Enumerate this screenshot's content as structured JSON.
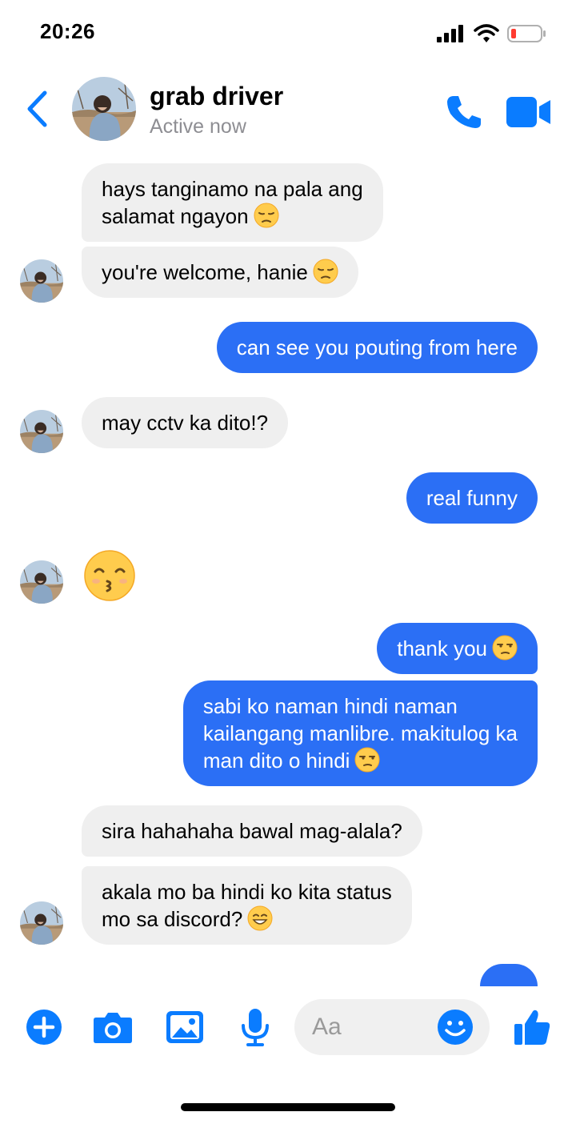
{
  "status_bar": {
    "time": "20:26"
  },
  "header": {
    "name": "grab driver",
    "status": "Active now"
  },
  "messages": {
    "m1_l1": "hays tanginamo na pala ang",
    "m1_l2": "salamat ngayon",
    "m2": "you're welcome, hanie",
    "m3": "can see you pouting from here",
    "m4": "may cctv ka dito!?",
    "m5": "real funny",
    "m6": "thank you",
    "m7_l1": "sabi ko naman hindi naman",
    "m7_l2": "kailangang manlibre. makitulog ka",
    "m7_l3": "man dito o hindi",
    "m8": "sira hahahaha bawal mag-alala?",
    "m9_l1": "akala mo ba hindi ko kita status",
    "m9_l2": "mo sa discord?"
  },
  "composer": {
    "placeholder": "Aa"
  },
  "colors": {
    "accent": "#0a7cff",
    "outgoing_bubble": "#2b6ff5",
    "incoming_bubble": "#efefef"
  },
  "icons": [
    "back-chevron-icon",
    "phone-icon",
    "video-camera-icon",
    "plus-icon",
    "camera-icon",
    "photo-icon",
    "microphone-icon",
    "smiley-icon",
    "thumbs-up-icon",
    "pensive-face-emoji",
    "kissing-face-emoji",
    "unamused-face-emoji",
    "grinning-face-emoji"
  ]
}
